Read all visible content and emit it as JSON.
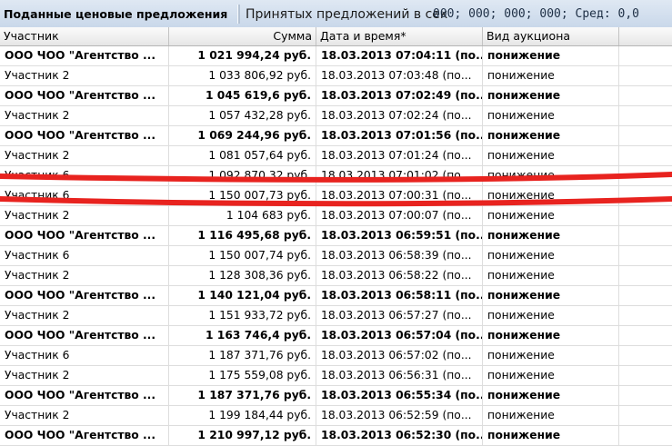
{
  "panel": {
    "title": "Поданные ценовые предложения",
    "accepted_label": "Принятых предложений в сек",
    "mono_text": "000; 000; 000; 000;  Сред: 0,0"
  },
  "columns": [
    "Участник",
    "Сумма",
    "Дата и время*",
    "Вид аукциона",
    ""
  ],
  "rows": [
    {
      "participant": "ООО ЧОО \"Агентство ...",
      "amount": "1 021 994,24 руб.",
      "datetime": "18.03.2013 07:04:11 (по...",
      "type": "понижение",
      "bold": true
    },
    {
      "participant": "Участник 2",
      "amount": "1 033 806,92 руб.",
      "datetime": "18.03.2013 07:03:48 (по...",
      "type": "понижение",
      "bold": false
    },
    {
      "participant": "ООО ЧОО \"Агентство ...",
      "amount": "1 045 619,6 руб.",
      "datetime": "18.03.2013 07:02:49 (по...",
      "type": "понижение",
      "bold": true
    },
    {
      "participant": "Участник 2",
      "amount": "1 057 432,28 руб.",
      "datetime": "18.03.2013 07:02:24 (по...",
      "type": "понижение",
      "bold": false
    },
    {
      "participant": "ООО ЧОО \"Агентство ...",
      "amount": "1 069 244,96 руб.",
      "datetime": "18.03.2013 07:01:56 (по...",
      "type": "понижение",
      "bold": true
    },
    {
      "participant": "Участник 2",
      "amount": "1 081 057,64 руб.",
      "datetime": "18.03.2013 07:01:24 (по...",
      "type": "понижение",
      "bold": false
    },
    {
      "participant": "Участник 6",
      "amount": "1 092 870,32 руб.",
      "datetime": "18.03.2013 07:01:02 (по...",
      "type": "понижение",
      "bold": false
    },
    {
      "participant": "Участник 6",
      "amount": "1 150 007,73 руб.",
      "datetime": "18.03.2013 07:00:31 (по...",
      "type": "понижение",
      "bold": false
    },
    {
      "participant": "Участник 2",
      "amount": "1 104 683 руб.",
      "datetime": "18.03.2013 07:00:07 (по...",
      "type": "понижение",
      "bold": false
    },
    {
      "participant": "ООО ЧОО \"Агентство ...",
      "amount": "1 116 495,68 руб.",
      "datetime": "18.03.2013 06:59:51 (по...",
      "type": "понижение",
      "bold": true
    },
    {
      "participant": "Участник 6",
      "amount": "1 150 007,74 руб.",
      "datetime": "18.03.2013 06:58:39 (по...",
      "type": "понижение",
      "bold": false
    },
    {
      "participant": "Участник 2",
      "amount": "1 128 308,36 руб.",
      "datetime": "18.03.2013 06:58:22 (по...",
      "type": "понижение",
      "bold": false
    },
    {
      "participant": "ООО ЧОО \"Агентство ...",
      "amount": "1 140 121,04 руб.",
      "datetime": "18.03.2013 06:58:11 (по...",
      "type": "понижение",
      "bold": true
    },
    {
      "participant": "Участник 2",
      "amount": "1 151 933,72 руб.",
      "datetime": "18.03.2013 06:57:27 (по...",
      "type": "понижение",
      "bold": false
    },
    {
      "participant": "ООО ЧОО \"Агентство ...",
      "amount": "1 163 746,4 руб.",
      "datetime": "18.03.2013 06:57:04 (по...",
      "type": "понижение",
      "bold": true
    },
    {
      "participant": "Участник 6",
      "amount": "1 187 371,76 руб.",
      "datetime": "18.03.2013 06:57:02 (по...",
      "type": "понижение",
      "bold": false
    },
    {
      "participant": "Участник 2",
      "amount": "1 175 559,08 руб.",
      "datetime": "18.03.2013 06:56:31 (по...",
      "type": "понижение",
      "bold": false
    },
    {
      "participant": "ООО ЧОО \"Агентство ...",
      "amount": "1 187 371,76 руб.",
      "datetime": "18.03.2013 06:55:34 (по...",
      "type": "понижение",
      "bold": true
    },
    {
      "participant": "Участник 2",
      "amount": "1 199 184,44 руб.",
      "datetime": "18.03.2013 06:52:59 (по...",
      "type": "понижение",
      "bold": false
    },
    {
      "participant": "ООО ЧОО \"Агентство ...",
      "amount": "1 210 997,12 руб.",
      "datetime": "18.03.2013 06:52:30 (по...",
      "type": "понижение",
      "bold": true
    }
  ],
  "colors": {
    "highlight_stroke": "#e8231f",
    "title_bg": "#d3dfee",
    "header_bg": "#eeeeee"
  }
}
